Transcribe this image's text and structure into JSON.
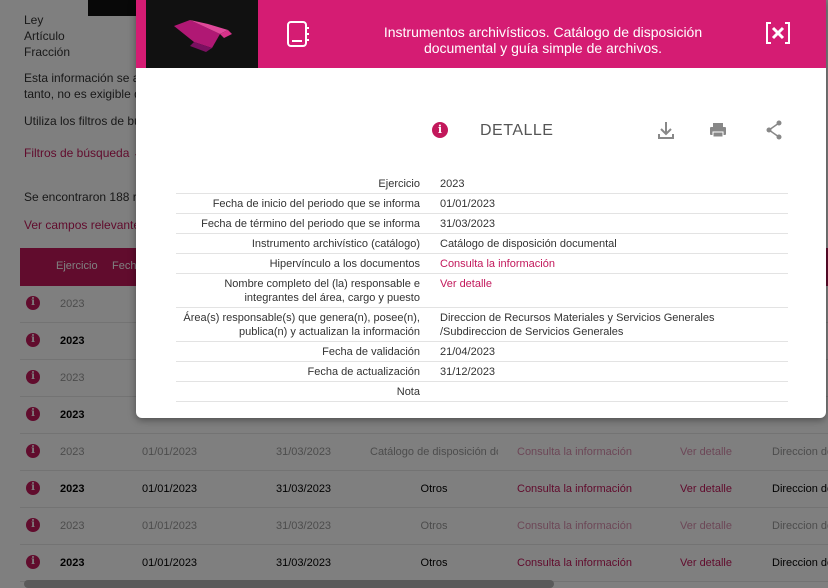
{
  "background": {
    "meta": [
      "Ley",
      "Artículo",
      "Fracción"
    ],
    "note_lines": [
      "Esta información se ac",
      "tanto, no es exigible qu"
    ],
    "utiliza": "Utiliza los filtros de bú",
    "filtros": "Filtros de búsqueda ⌄",
    "found": "Se encontraron 188 re",
    "ver_campos": "Ver campos relevantes",
    "table_header": [
      "Ejercicio",
      "Fecha"
    ],
    "rows": [
      {
        "year": "2023",
        "faded": true
      },
      {
        "year": "2023",
        "faded": false
      },
      {
        "year": "2023",
        "faded": true
      },
      {
        "year": "2023",
        "faded": false
      },
      {
        "year": "2023",
        "start": "01/01/2023",
        "end": "31/03/2023",
        "instrument": "Catálogo de disposición doc...",
        "link": "Consulta la información",
        "detail": "Ver detalle",
        "area": "Direccion de",
        "faded": true
      },
      {
        "year": "2023",
        "start": "01/01/2023",
        "end": "31/03/2023",
        "instrument": "Otros",
        "link": "Consulta la información",
        "detail": "Ver detalle",
        "area": "Direccion de",
        "faded": false
      },
      {
        "year": "2023",
        "start": "01/01/2023",
        "end": "31/03/2023",
        "instrument": "Otros",
        "link": "Consulta la información",
        "detail": "Ver detalle",
        "area": "Direccion de",
        "faded": true
      },
      {
        "year": "2023",
        "start": "01/01/2023",
        "end": "31/03/2023",
        "instrument": "Otros",
        "link": "Consulta la información",
        "detail": "Ver detalle",
        "area": "Direccion de",
        "faded": false
      }
    ]
  },
  "modal": {
    "title": "Instrumentos archivísticos. Catálogo de disposición documental y guía simple de archivos.",
    "detail_label": "DETALLE",
    "icons": [
      "info-icon",
      "book-icon",
      "close-icon",
      "download-icon",
      "print-icon",
      "share-icon"
    ],
    "fields": [
      {
        "label": "Ejercicio",
        "value": "2023",
        "link": false
      },
      {
        "label": "Fecha de inicio del periodo que se informa",
        "value": "01/01/2023",
        "link": false
      },
      {
        "label": "Fecha de término del periodo que se informa",
        "value": "31/03/2023",
        "link": false
      },
      {
        "label": "Instrumento archivístico (catálogo)",
        "value": "Catálogo de disposición documental",
        "link": false
      },
      {
        "label": "Hipervínculo a los documentos",
        "value": "Consulta la información",
        "link": true
      },
      {
        "label": "Nombre completo del (la) responsable e integrantes del área, cargo y puesto",
        "value": "Ver detalle",
        "link": true
      },
      {
        "label": "Área(s) responsable(s) que genera(n), posee(n), publica(n) y actualizan la información",
        "value": "Direccion de Recursos Materiales y Servicios Generales /Subdireccion de Servicios Generales",
        "link": false
      },
      {
        "label": "Fecha de validación",
        "value": "21/04/2023",
        "link": false
      },
      {
        "label": "Fecha de actualización",
        "value": "31/12/2023",
        "link": false
      },
      {
        "label": "Nota",
        "value": "",
        "link": false
      }
    ]
  },
  "colors": {
    "accent": "#d51c73",
    "link": "#c2185b"
  }
}
